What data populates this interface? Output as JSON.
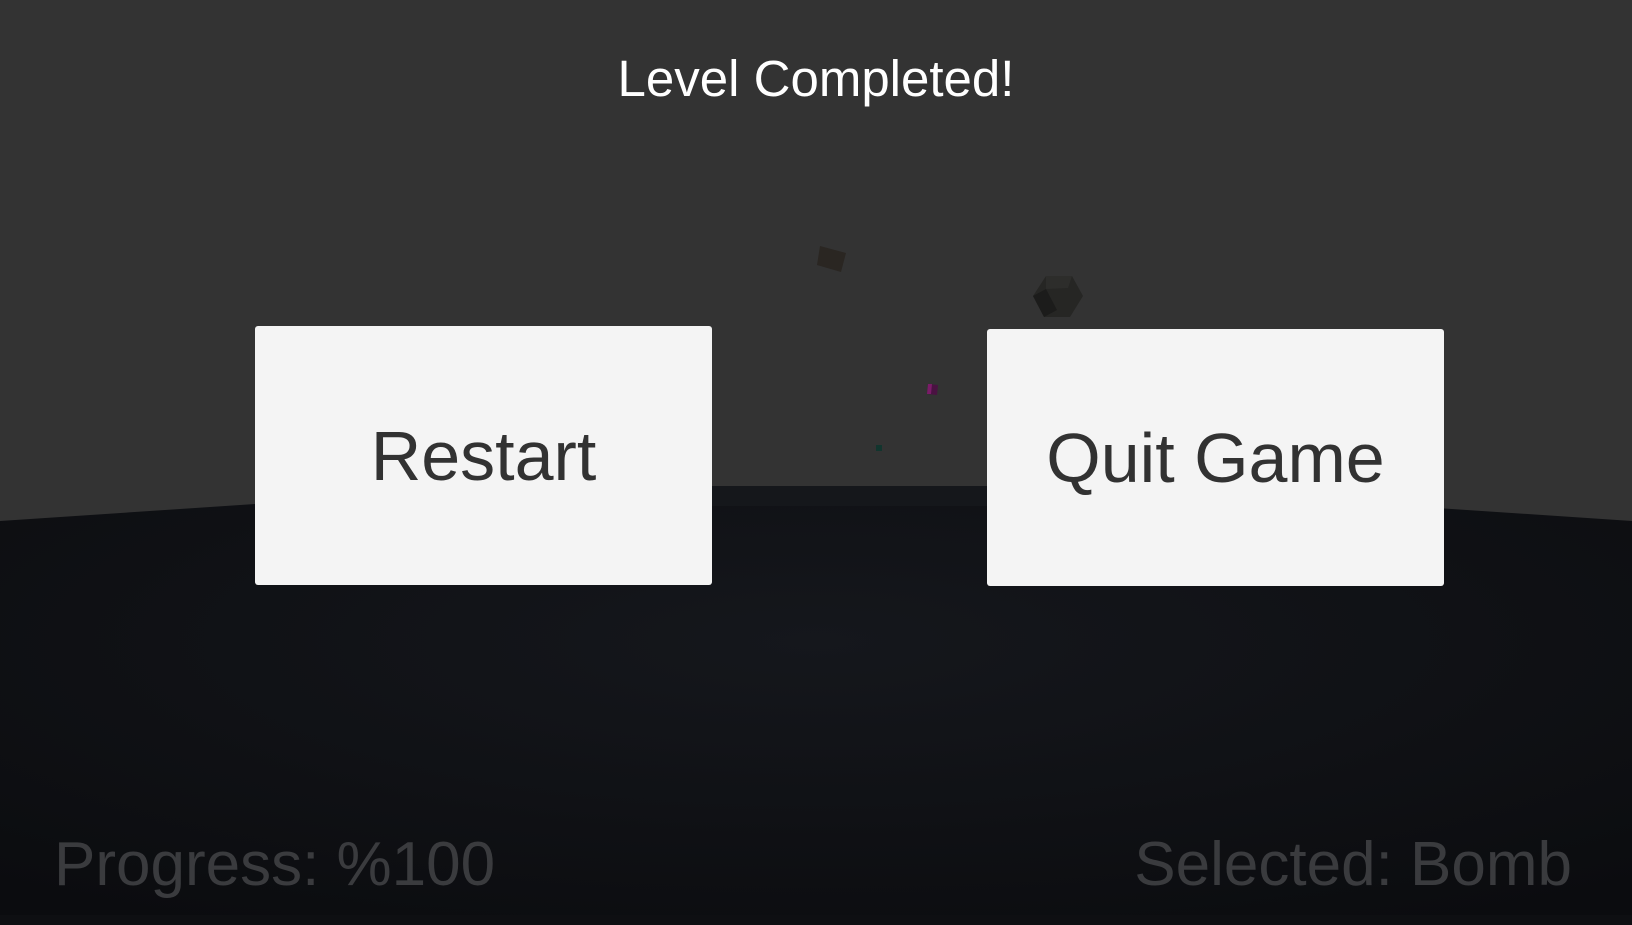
{
  "title": "Level Completed!",
  "buttons": {
    "restart_label": "Restart",
    "quit_label": "Quit Game"
  },
  "hud": {
    "progress_text": "Progress: %100",
    "selected_text": "Selected: Bomb"
  },
  "colors": {
    "sky": "#333333",
    "ground": "#111318",
    "button_bg": "#f4f4f4",
    "button_text": "#323232",
    "title_text": "#ffffff",
    "hud_text": "#3a3b3e"
  }
}
